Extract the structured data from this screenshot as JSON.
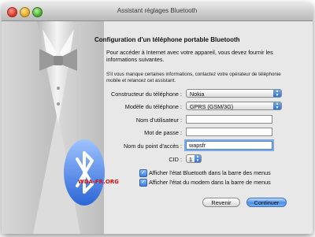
{
  "window": {
    "title": "Assistant réglages Bluetooth"
  },
  "heading": "Configuration d'un téléphone portable Bluetooth",
  "intro": "Pour accéder à Internet avec votre appareil, vous devez fournir les informations suivantes.",
  "note": "S'il vous manque certaines informations, contactez votre opérateur de téléphonie mobile et relancez cet assistant.",
  "form": {
    "manufacturer": {
      "label": "Constructeur du téléphone :",
      "value": "Nokia"
    },
    "model": {
      "label": "Modèle du téléphone :",
      "value": "GPRS (GSM/3G)"
    },
    "username": {
      "label": "Nom d'utilisateur :",
      "value": ""
    },
    "password": {
      "label": "Mot de passe :",
      "value": ""
    },
    "apn": {
      "label": "Nom du point d'accès :",
      "value": "wapsfr"
    },
    "cid": {
      "label": "CID :",
      "value": "1"
    }
  },
  "checkboxes": [
    {
      "label": "Afficher l'état Bluetooth dans la barre des menus",
      "checked": true
    },
    {
      "label": "Afficher l'état du modem dans la barre de menus",
      "checked": true
    }
  ],
  "buttons": {
    "back": "Revenir",
    "next": "Continuer"
  },
  "watermark": "WDA-FR.ORG",
  "icons": {
    "close": "close-icon",
    "minimize": "minimize-icon",
    "zoom": "zoom-icon",
    "bluetooth": "bluetooth-icon"
  }
}
